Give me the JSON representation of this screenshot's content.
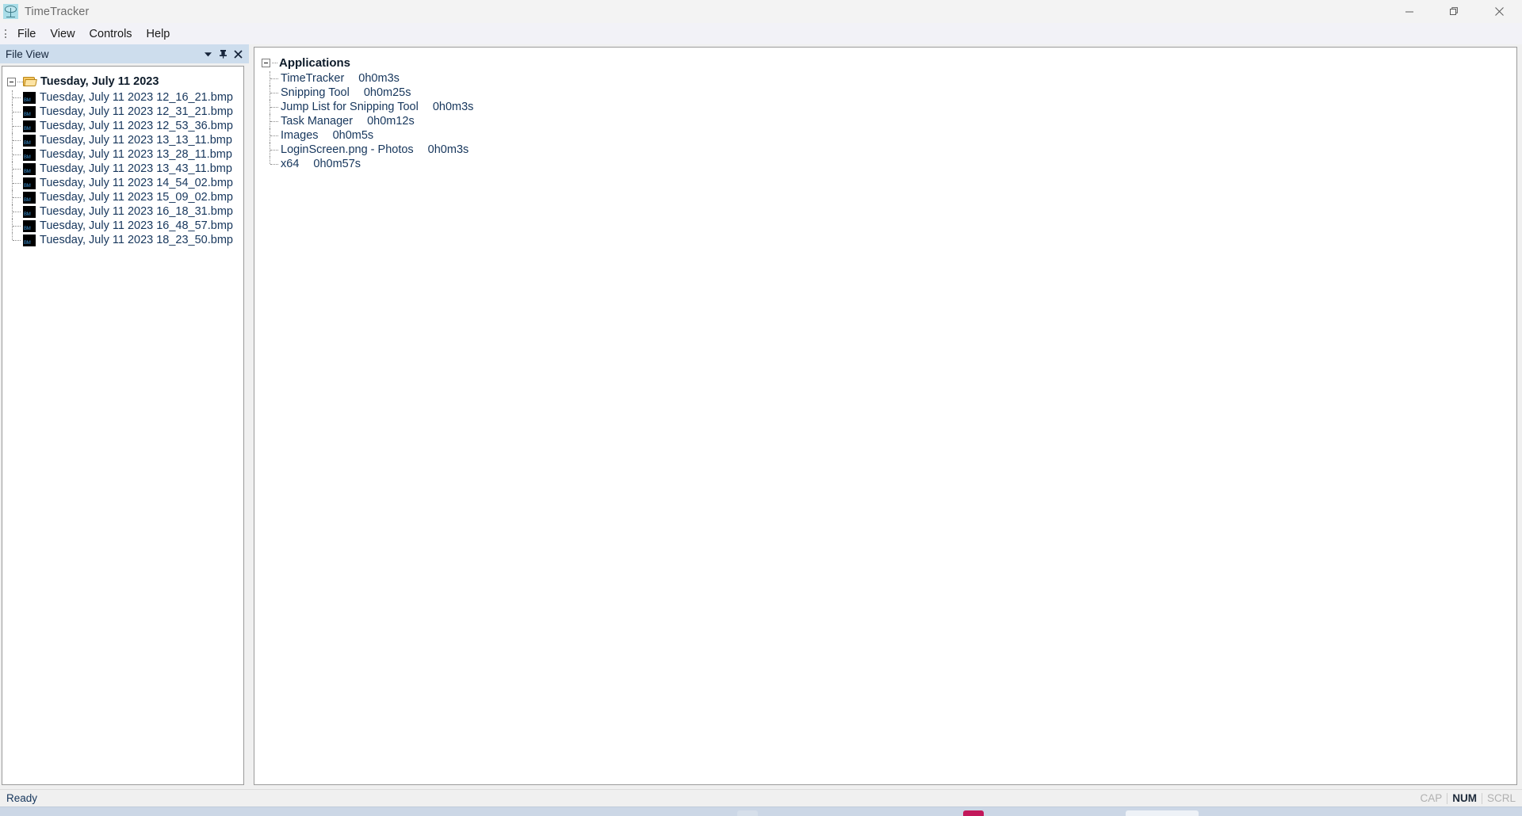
{
  "window": {
    "title": "TimeTracker",
    "icon": "timetracker-icon",
    "minimize_label": "Minimize",
    "restore_label": "Restore",
    "close_label": "Close"
  },
  "menu": {
    "items": [
      {
        "label": "File"
      },
      {
        "label": "View"
      },
      {
        "label": "Controls"
      },
      {
        "label": "Help"
      }
    ]
  },
  "file_view": {
    "caption": "File View",
    "buttons": {
      "dropdown": "chevron-down-icon",
      "pin": "pin-icon",
      "close": "close-icon"
    },
    "tree": {
      "root": "Tuesday, July 11 2023",
      "files": [
        "Tuesday, July 11 2023 12_16_21.bmp",
        "Tuesday, July 11 2023 12_31_21.bmp",
        "Tuesday, July 11 2023 12_53_36.bmp",
        "Tuesday, July 11 2023 13_13_11.bmp",
        "Tuesday, July 11 2023 13_28_11.bmp",
        "Tuesday, July 11 2023 13_43_11.bmp",
        "Tuesday, July 11 2023 14_54_02.bmp",
        "Tuesday, July 11 2023 15_09_02.bmp",
        "Tuesday, July 11 2023 16_18_31.bmp",
        "Tuesday, July 11 2023 16_48_57.bmp",
        "Tuesday, July 11 2023 18_23_50.bmp"
      ]
    }
  },
  "main": {
    "tree": {
      "root": "Applications",
      "entries": [
        {
          "name": "TimeTracker",
          "time": "0h0m3s"
        },
        {
          "name": "Snipping Tool",
          "time": "0h0m25s"
        },
        {
          "name": "Jump List for Snipping Tool",
          "time": "0h0m3s"
        },
        {
          "name": "Task Manager",
          "time": "0h0m12s"
        },
        {
          "name": "Images",
          "time": "0h0m5s"
        },
        {
          "name": "LoginScreen.png - Photos",
          "time": "0h0m3s"
        },
        {
          "name": "x64",
          "time": "0h0m57s"
        }
      ]
    }
  },
  "status_bar": {
    "message": "Ready",
    "indicators": [
      {
        "label": "CAP",
        "active": false
      },
      {
        "label": "NUM",
        "active": true
      },
      {
        "label": "SCRL",
        "active": false
      }
    ]
  }
}
